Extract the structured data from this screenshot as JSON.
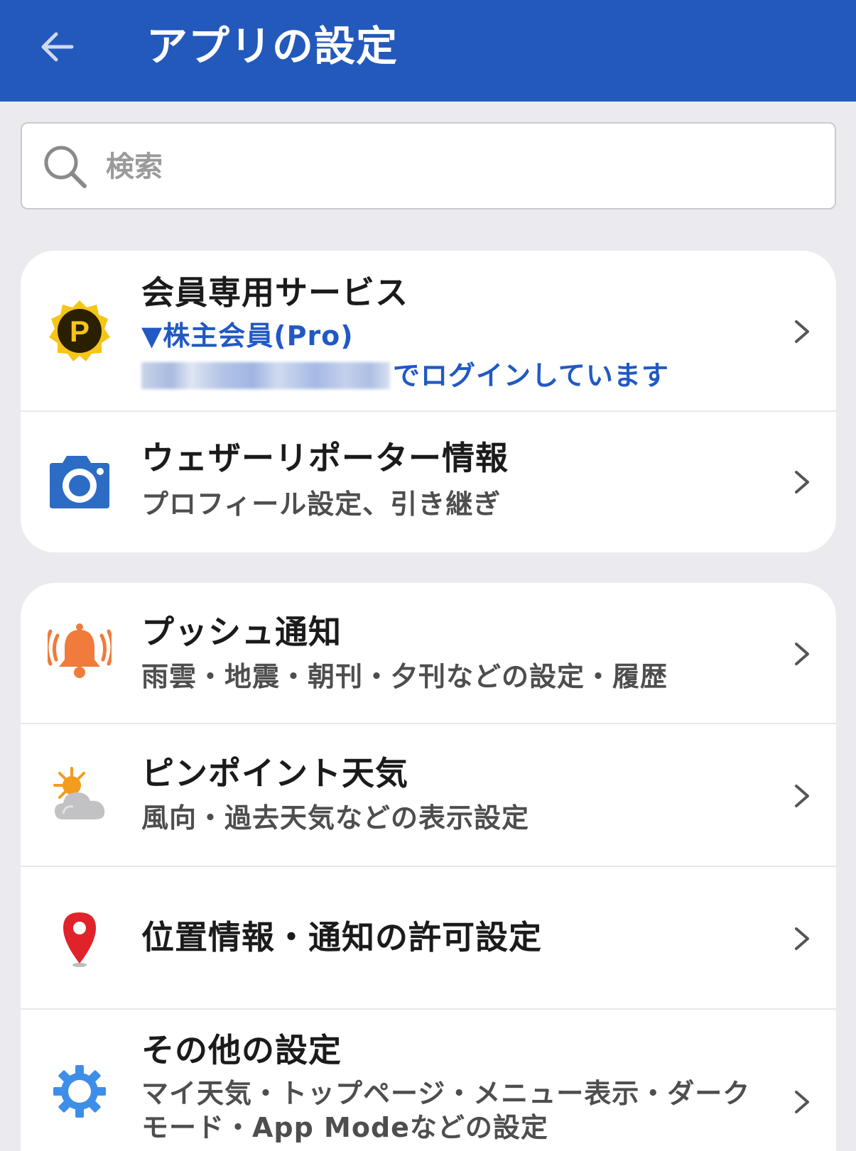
{
  "appbar": {
    "title": "アプリの設定"
  },
  "search": {
    "placeholder": "検索"
  },
  "account_card": {
    "member": {
      "title": "会員専用サービス",
      "status": "▼株主会員(Pro)",
      "login_text": "でログインしています"
    },
    "reporter": {
      "title": "ウェザーリポーター情報",
      "subtitle": "プロフィール設定、引き継ぎ"
    }
  },
  "settings_card": {
    "push": {
      "title": "プッシュ通知",
      "subtitle": "雨雲・地震・朝刊・夕刊などの設定・履歴"
    },
    "pinpoint": {
      "title": "ピンポイント天気",
      "subtitle": "風向・過去天気などの表示設定"
    },
    "location": {
      "title": "位置情報・通知の許可設定"
    },
    "other": {
      "title": "その他の設定",
      "subtitle_line1": "マイ天気・トップページ・メニュー表示・ダーク",
      "subtitle_line2": "モード・App Modeなどの設定"
    }
  },
  "colors": {
    "appbar": "#2359bb",
    "accent_blue": "#2159c4",
    "bell_orange": "#f07b3a",
    "pin_red": "#e0232a",
    "gear_blue": "#3d8ee8"
  },
  "icons": {
    "back": "arrow-left-icon",
    "search": "search-icon",
    "member": "premium-badge-icon",
    "reporter": "camera-icon",
    "push": "bell-icon",
    "pinpoint": "sun-cloud-icon",
    "location": "location-pin-icon",
    "other": "gear-icon",
    "chevron": "chevron-right-icon"
  }
}
